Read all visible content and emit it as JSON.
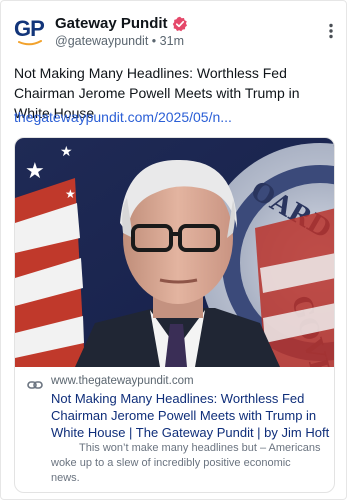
{
  "post": {
    "author": {
      "display_name": "Gateway Pundit",
      "handle": "@gatewaypundit",
      "separator": "•",
      "time_ago": "31m",
      "avatar_text": "GP",
      "verified_icon": "verified-badge-icon"
    },
    "menu_icon": "more-vertical-icon",
    "text": "Not Making Many Headlines: Worthless Fed Chairman Jerome Powell Meets with Trump in White House",
    "link_text": "thegatewaypundit.com/2025/05/n...",
    "card": {
      "link_icon": "link-icon",
      "domain": "www.thegatewaypundit.com",
      "title": "Not Making Many Headlines: Worthless Fed Chairman Jerome Powell Meets with Trump in White House | The Gateway Pundit | by Jim Hoft",
      "description": "This won’t make many headlines but – Americans woke up to a slew of incredibly positive economic news.",
      "image_seal_text": "OARD OF GOVER"
    }
  },
  "colors": {
    "link": "#2b5fd6",
    "card_title": "#0f2e7a",
    "verified": "#e5486a",
    "brand_navy": "#12357a",
    "brand_orange": "#f2a22c"
  }
}
